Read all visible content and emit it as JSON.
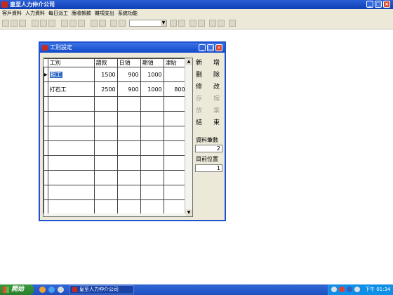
{
  "app": {
    "title": "皇至人力仲介公司"
  },
  "menu": [
    "客戶資料",
    "人力資料",
    "每日派工",
    "應收帳款",
    "雜項支出",
    "系統功能"
  ],
  "toolbar": {
    "combo_value": ""
  },
  "dialog": {
    "title": "工別設定",
    "columns": [
      "工別",
      "請款",
      "日領",
      "期領",
      "津貼"
    ],
    "rows": [
      {
        "type": "粗工",
        "request": "1500",
        "daily": "900",
        "period": "1000",
        "allowance": ""
      },
      {
        "type": "打石工",
        "request": "2500",
        "daily": "900",
        "period": "1000",
        "allowance": "800"
      }
    ],
    "buttons": {
      "new": [
        "新",
        "增"
      ],
      "delete": [
        "刪",
        "除"
      ],
      "edit": [
        "修",
        "改"
      ],
      "save": [
        "存",
        "檔"
      ],
      "abort": [
        "放",
        "棄"
      ],
      "close": [
        "結",
        "束"
      ]
    },
    "record_count_label": "資料筆數",
    "record_count": "2",
    "current_position_label": "目前位置",
    "current_position": "1"
  },
  "taskbar": {
    "start_label": "開始",
    "task_label": "皇至人力仲介公司",
    "clock": "下午 01:34"
  }
}
